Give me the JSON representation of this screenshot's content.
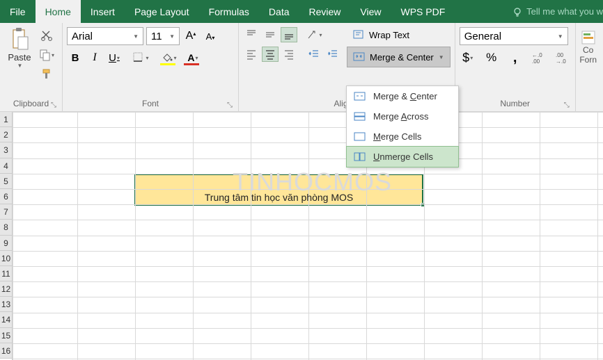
{
  "tabs": {
    "file": "File",
    "home": "Home",
    "insert": "Insert",
    "page_layout": "Page Layout",
    "formulas": "Formulas",
    "data": "Data",
    "review": "Review",
    "view": "View",
    "wps_pdf": "WPS PDF",
    "tell_me": "Tell me what you w"
  },
  "clipboard": {
    "paste": "Paste",
    "label": "Clipboard"
  },
  "font": {
    "name": "Arial",
    "size": "11",
    "bold": "B",
    "italic": "I",
    "underline": "U",
    "inc": "A",
    "dec": "A",
    "label": "Font"
  },
  "alignment": {
    "wrap": "Wrap Text",
    "merge": "Merge & Center",
    "label": "Alignm"
  },
  "merge_menu": {
    "merge_center": "Merge & Center",
    "merge_across": "Merge Across",
    "merge_cells": "Merge Cells",
    "unmerge": "Unmerge Cells"
  },
  "number": {
    "format": "General",
    "label": "Number"
  },
  "right": {
    "cond1": "Co",
    "cond2": "Forn"
  },
  "sheet": {
    "merged_text": "Trung tâm tin học văn phòng MOS",
    "watermark": "TINHOCMOS"
  },
  "rows": [
    "1",
    "2",
    "3",
    "4",
    "5",
    "6",
    "7",
    "8",
    "9",
    "10",
    "11",
    "12",
    "13",
    "14",
    "15",
    "16"
  ]
}
